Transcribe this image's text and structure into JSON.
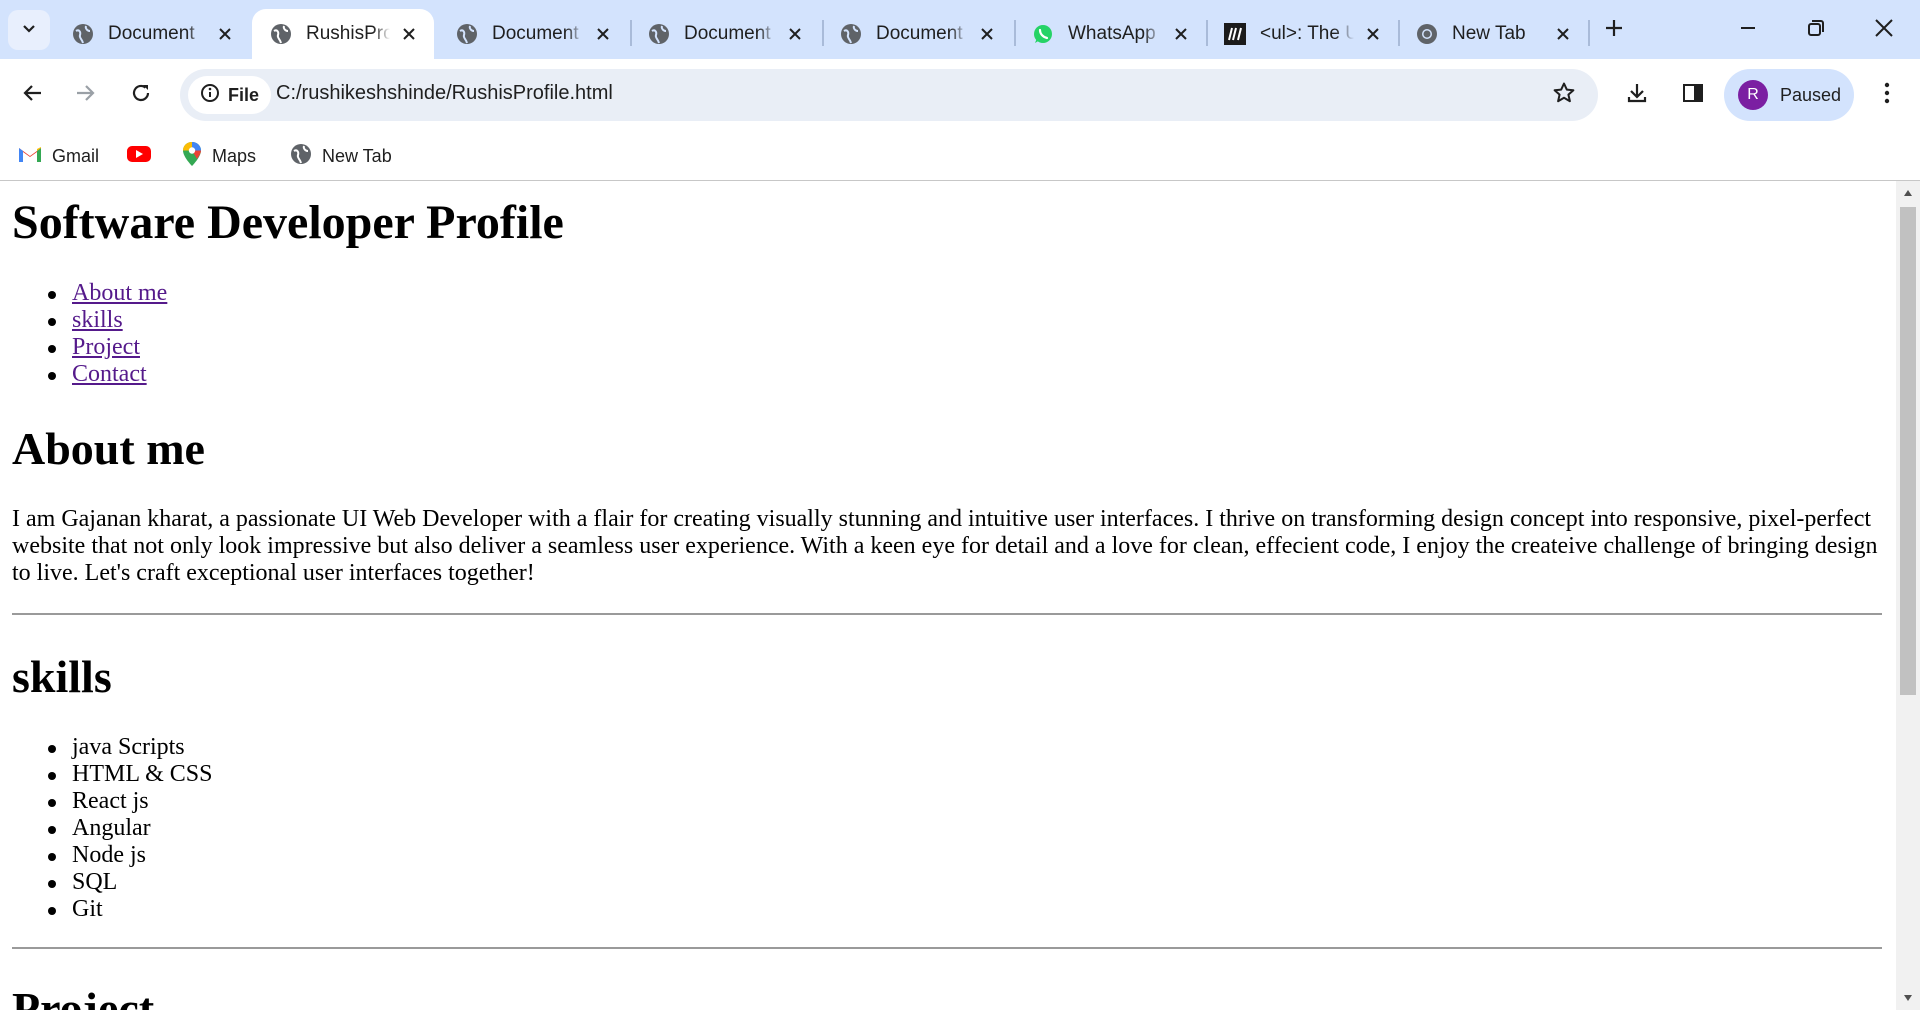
{
  "browser": {
    "tabs": [
      {
        "title": "Document",
        "favicon": "globe-icon"
      },
      {
        "title": "RushisProfile.html",
        "favicon": "globe-icon",
        "active": true
      },
      {
        "title": "Document",
        "favicon": "globe-icon"
      },
      {
        "title": "Document",
        "favicon": "globe-icon"
      },
      {
        "title": "Document",
        "favicon": "globe-icon"
      },
      {
        "title": "WhatsApp",
        "favicon": "whatsapp-icon"
      },
      {
        "title": "<ul>: The Unordered List element",
        "favicon": "mdn-icon"
      },
      {
        "title": "New Tab",
        "favicon": "chrome-icon"
      }
    ],
    "omnibox": {
      "chip_label": "File",
      "url": "C:/rushikeshshinde/RushisProfile.html"
    },
    "profile": {
      "initial": "R",
      "status": "Paused",
      "avatar_color": "#7b1fa2"
    },
    "bookmarks": [
      {
        "label": "Gmail",
        "icon": "gmail-icon"
      },
      {
        "label": "",
        "icon": "youtube-icon"
      },
      {
        "label": "Maps",
        "icon": "maps-icon"
      },
      {
        "label": "New Tab",
        "icon": "globe-icon"
      }
    ],
    "colors": {
      "tabstrip": "#d3e3fd",
      "omnibox": "#e9eef6",
      "link_visited": "#551a8b"
    }
  },
  "page": {
    "title": "Software Developer Profile",
    "nav": [
      "About me",
      "skills",
      "Project",
      "Contact"
    ],
    "about": {
      "heading": "About me",
      "text": "I am Gajanan kharat, a passionate UI Web Developer with a flair for creating visually stunning and intuitive user interfaces. I thrive on transforming design concept into responsive, pixel-perfect website that not only look impressive but also deliver a seamless user experience. With a keen eye for detail and a love for clean, effecient code, I enjoy the createive challenge of bringing design to live. Let's craft exceptional user interfaces together!"
    },
    "skills": {
      "heading": "skills",
      "items": [
        "java Scripts",
        "HTML & CSS",
        "React js",
        "Angular",
        "Node js",
        "SQL",
        "Git"
      ]
    },
    "project": {
      "heading": "Project"
    }
  }
}
